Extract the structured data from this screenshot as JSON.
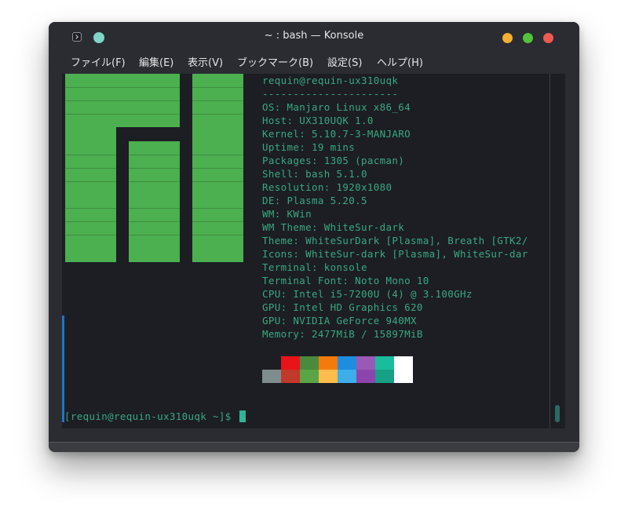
{
  "window": {
    "title": "~ : bash — Konsole"
  },
  "menu": {
    "file": "ファイル(F)",
    "edit": "編集(E)",
    "view": "表示(V)",
    "bookmarks": "ブックマーク(B)",
    "settings": "設定(S)",
    "help": "ヘルプ(H)"
  },
  "neofetch": {
    "lines": [
      "requin@requin-ux310uqk",
      "----------------------",
      "OS: Manjaro Linux x86_64",
      "Host: UX310UQK 1.0",
      "Kernel: 5.10.7-3-MANJARO",
      "Uptime: 19 mins",
      "Packages: 1305 (pacman)",
      "Shell: bash 5.1.0",
      "Resolution: 1920x1080",
      "DE: Plasma 5.20.5",
      "WM: KWin",
      "WM Theme: WhiteSur-dark",
      "Theme: WhiteSurDark [Plasma], Breath [GTK2/",
      "Icons: WhiteSur-dark [Plasma], WhiteSur-dar",
      "Terminal: konsole",
      "Terminal Font: Noto Mono 10",
      "CPU: Intel i5-7200U (4) @ 3.100GHz",
      "GPU: Intel HD Graphics 620",
      "GPU: NVIDIA GeForce 940MX",
      "Memory: 2477MiB / 15897MiB"
    ],
    "palette_top": [
      "#1c1e24",
      "#e8141a",
      "#4a8a3c",
      "#f57a0c",
      "#1e8de0",
      "#9b59b6",
      "#1abc9c",
      "#ffffff"
    ],
    "palette_bottom": [
      "#7f8c8d",
      "#c0392b",
      "#5aa545",
      "#fdbc4b",
      "#3daee9",
      "#8e44ad",
      "#16a085",
      "#ffffff"
    ]
  },
  "prompt": {
    "text": "[requin@requin-ux310uqk ~]$ "
  },
  "colors": {
    "accent_text": "#3aa87e",
    "logo_green": "#4caf50",
    "terminal_bg": "#1c1e24"
  }
}
